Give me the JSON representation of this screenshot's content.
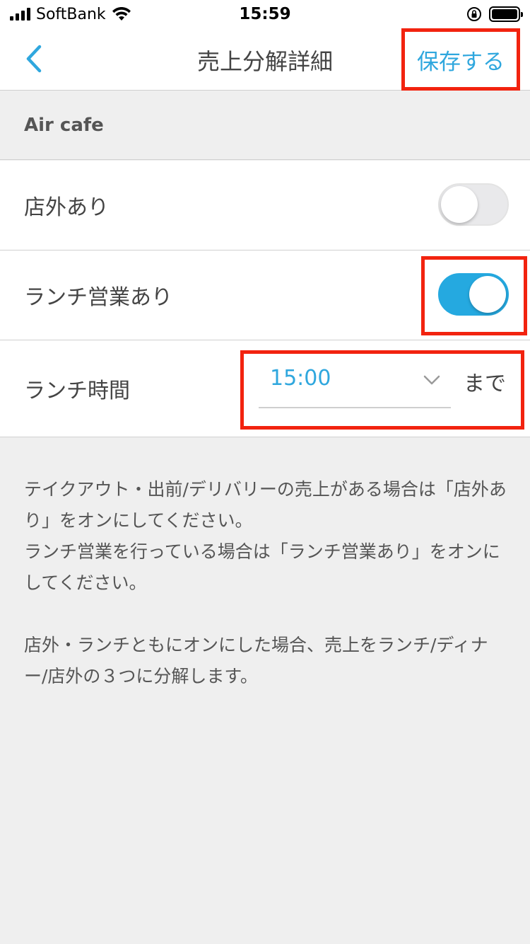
{
  "status_bar": {
    "carrier": "SoftBank",
    "time": "15:59"
  },
  "nav": {
    "title": "売上分解詳細",
    "save_label": "保存する"
  },
  "section": {
    "store_name": "Air cafe"
  },
  "settings": {
    "outside_label": "店外あり",
    "outside_enabled": false,
    "lunch_label": "ランチ営業あり",
    "lunch_enabled": true,
    "lunch_time_label": "ランチ時間",
    "lunch_time_value": "15:00",
    "lunch_time_suffix": "まで"
  },
  "description": {
    "line1": "テイクアウト・出前/デリバリーの売上がある場合は「店外あり」をオンにしてください。",
    "line2": "ランチ営業を行っている場合は「ランチ営業あり」をオンにしてください。",
    "line3": "店外・ランチともにオンにした場合、売上をランチ/ディナー/店外の３つに分解します。"
  },
  "colors": {
    "accent": "#2fa7de",
    "toggle_on": "#25a9e0",
    "highlight": "#f2230f"
  }
}
